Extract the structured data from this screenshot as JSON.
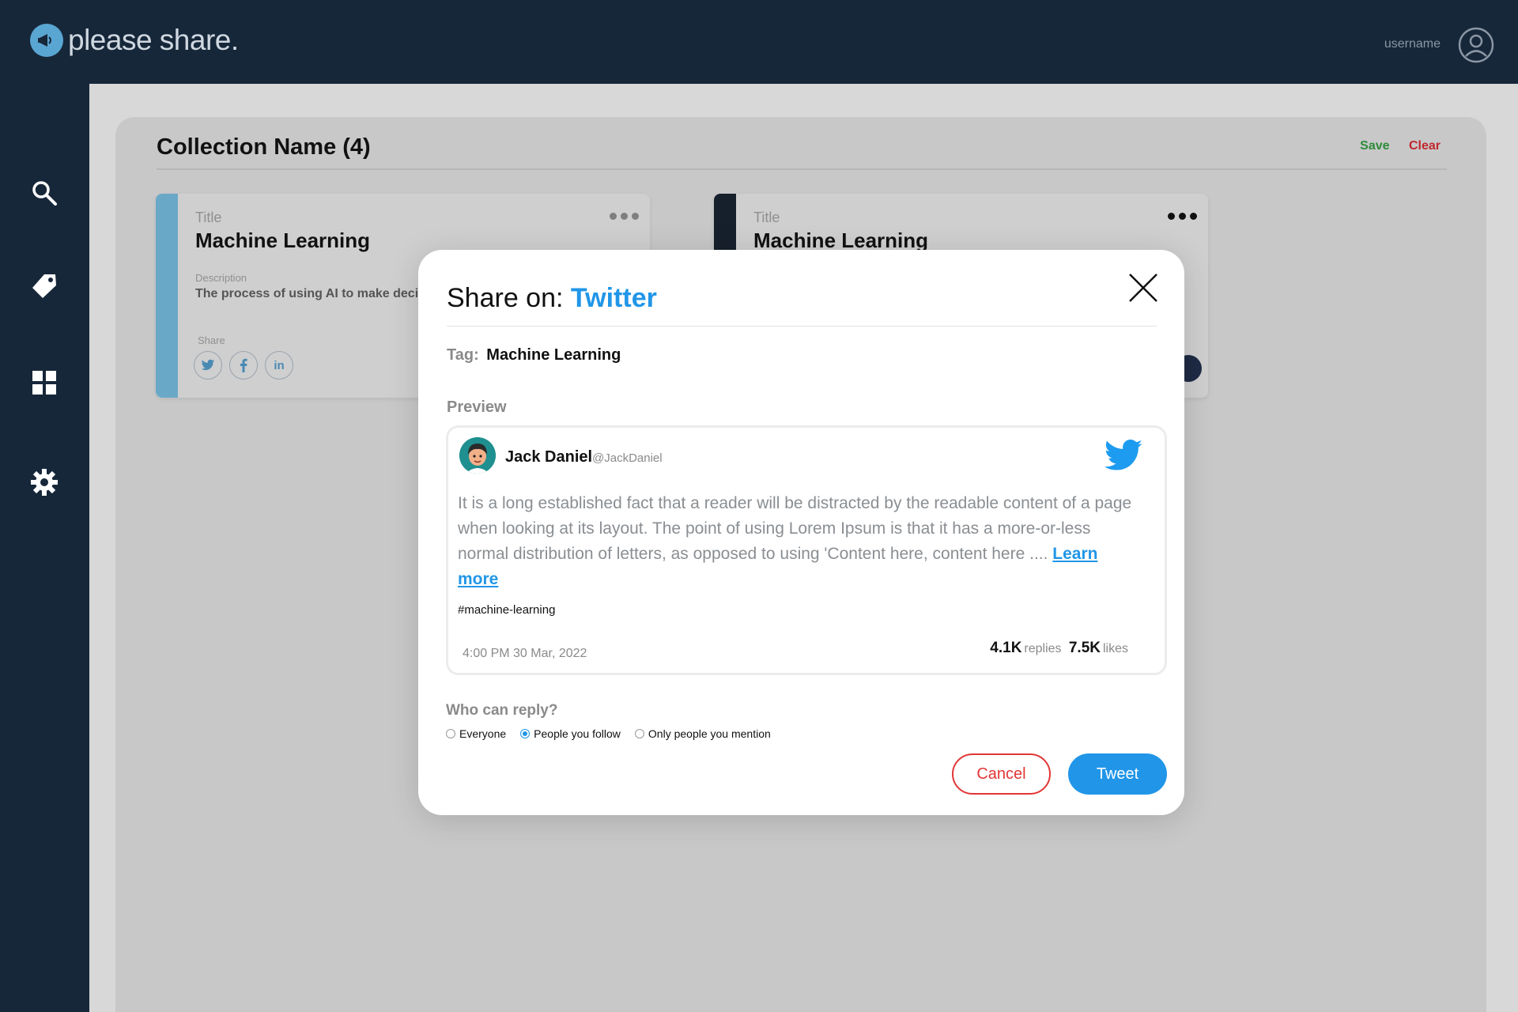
{
  "app": {
    "logo_text": "please share.",
    "username": "username"
  },
  "sidebar": {
    "items": [
      {
        "icon": "search-icon"
      },
      {
        "icon": "tag-icon"
      },
      {
        "icon": "grid-icon"
      },
      {
        "icon": "gear-icon"
      }
    ]
  },
  "collection": {
    "title": "Collection Name (4)",
    "save_label": "Save",
    "clear_label": "Clear"
  },
  "cards": [
    {
      "title_label": "Title",
      "title": "Machine Learning",
      "description_label": "Description",
      "description": "The process of using AI to make decisi",
      "share_label": "Share",
      "share_icons": [
        "twitter-icon",
        "facebook-icon",
        "linkedin-icon"
      ],
      "linkedin_text": "in",
      "stripe_color": "#6aa8c8"
    },
    {
      "title_label": "Title",
      "title": "Machine Learning",
      "stripe_color": "#16202c"
    }
  ],
  "modal": {
    "heading_prefix": "Share on:",
    "platform": "Twitter",
    "tag_label": "Tag:",
    "tag_value": "Machine Learning",
    "preview_label": "Preview",
    "tweet": {
      "author": "Jack Daniel",
      "handle": "@JackDaniel",
      "body": "It is a long established fact that a reader will be distracted by the readable content of a page when looking at its layout. The point of using Lorem Ipsum is that it has a more-or-less normal distribution of letters, as opposed to using 'Content here, content here ....",
      "learn_more": "Learn more",
      "hashtag": "#machine-learning",
      "timestamp": "4:00 PM 30 Mar, 2022",
      "replies_count": "4.1K",
      "replies_label": "replies",
      "likes_count": "7.5K",
      "likes_label": "likes"
    },
    "reply_label": "Who can reply?",
    "reply_options": [
      "Everyone",
      "People you follow",
      "Only people you mention"
    ],
    "reply_selected": "People you follow",
    "cancel_label": "Cancel",
    "tweet_label": "Tweet"
  },
  "colors": {
    "topbar": "#17273a",
    "twitter_blue": "#2196e8",
    "save_green": "#2e8b3a",
    "clear_red": "#c0282d",
    "cancel_red": "#e23636"
  }
}
